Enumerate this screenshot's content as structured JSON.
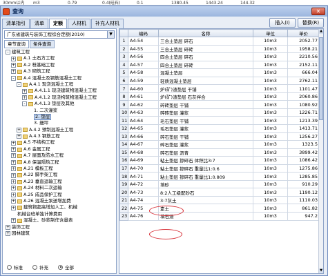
{
  "background_strip": [
    "30mm以内",
    "m3",
    "0.79",
    "0.4(硅石)",
    "0.1",
    "1380.45",
    "1443.24",
    "144.32"
  ],
  "window": {
    "title": "查询",
    "close_label": "✕"
  },
  "tabs": [
    "清单指引",
    "清单",
    "定额",
    "人材机",
    "补充人材机"
  ],
  "active_tab": 2,
  "buttons": {
    "insert": "插入(I)",
    "replace": "替换(R)"
  },
  "library": "广东省建筑与装饰工程综合定额(2010)",
  "subtabs": [
    "章节查询",
    "条件查询"
  ],
  "tree": [
    {
      "label": "建筑工程",
      "tog": "-",
      "depth": 0,
      "folder": false
    },
    {
      "label": "A.1 土石方工程",
      "tog": "+",
      "depth": 1,
      "folder": true
    },
    {
      "label": "A.2 桩基础工程",
      "tog": "+",
      "depth": 1,
      "folder": true
    },
    {
      "label": "A.3 砌筑工程",
      "tog": "+",
      "depth": 1,
      "folder": true
    },
    {
      "label": "A.4 混凝土及钢筋混凝土工程",
      "tog": "-",
      "depth": 1,
      "folder": true
    },
    {
      "label": "A.4.1 现浇混凝土工程",
      "tog": "-",
      "depth": 2,
      "folder": true
    },
    {
      "label": "A.4.1.1 现浇建筑物混凝土工程",
      "tog": "+",
      "depth": 3,
      "folder": true
    },
    {
      "label": "A.4.1.2 现浇构筑物混凝土工程",
      "tog": "+",
      "depth": 3,
      "folder": true
    },
    {
      "label": "A.4.1.3 垫层及其他",
      "tog": "-",
      "depth": 3,
      "folder": true
    },
    {
      "label": "1. 二次灌浆",
      "tog": "",
      "depth": 4,
      "folder": false
    },
    {
      "label": "2. 垫层",
      "tog": "",
      "depth": 4,
      "folder": false,
      "selected": true
    },
    {
      "label": "3. 细坪",
      "tog": "",
      "depth": 4,
      "folder": false
    },
    {
      "label": "A.4.2 预制混凝土工程",
      "tog": "+",
      "depth": 2,
      "folder": true
    },
    {
      "label": "A.4.3 钢筋工程",
      "tog": "+",
      "depth": 2,
      "folder": true
    },
    {
      "label": "A.5 不结构工程",
      "tog": "+",
      "depth": 1,
      "folder": true
    },
    {
      "label": "A.6 金属工程",
      "tog": "+",
      "depth": 1,
      "folder": true
    },
    {
      "label": "A.7 屋面及防水工程",
      "tog": "+",
      "depth": 1,
      "folder": true
    },
    {
      "label": "A.8 保温隔热工程",
      "tog": "+",
      "depth": 1,
      "folder": true
    },
    {
      "label": "A.21 模板工程",
      "tog": "+",
      "depth": 1,
      "folder": true
    },
    {
      "label": "A.22 脚手架工程",
      "tog": "+",
      "depth": 1,
      "folder": true
    },
    {
      "label": "A.23 垂直运输工程",
      "tog": "+",
      "depth": 1,
      "folder": true
    },
    {
      "label": "A.24 材料二次运输",
      "tog": "+",
      "depth": 1,
      "folder": true
    },
    {
      "label": "A.25 成品保护工程",
      "tog": "+",
      "depth": 1,
      "folder": true
    },
    {
      "label": "A.26 混凝土泵送增加费",
      "tog": "+",
      "depth": 1,
      "folder": true
    },
    {
      "label": "建筑物超高增加人工、机械",
      "tog": "+",
      "depth": 1,
      "folder": true
    },
    {
      "label": "机械台班单独计算费用",
      "tog": "",
      "depth": 1,
      "folder": false
    },
    {
      "label": "混凝土、砂浆制作含量表",
      "tog": "+",
      "depth": 1,
      "folder": true
    },
    {
      "label": "装饰工程",
      "tog": "+",
      "depth": 0,
      "folder": false
    },
    {
      "label": "园林建筑",
      "tog": "+",
      "depth": 0,
      "folder": false
    }
  ],
  "radios": [
    {
      "label": "标准",
      "checked": false
    },
    {
      "label": "补充",
      "checked": false
    },
    {
      "label": "全部",
      "checked": true
    }
  ],
  "table": {
    "headers": [
      "",
      "编码",
      "名称",
      "单位",
      "单价"
    ],
    "rows": [
      [
        "1",
        "A4-54",
        "三合土垫层 碎石",
        "10m3",
        "2052.77"
      ],
      [
        "2",
        "A4-55",
        "三合土垫层 碎砖",
        "10m3",
        "1958.21"
      ],
      [
        "3",
        "A4-56",
        "四合土垫层 碎石",
        "10m3",
        "2210.56"
      ],
      [
        "4",
        "A4-57",
        "四合土垫层 碎砖",
        "10m3",
        "2152.11"
      ],
      [
        "5",
        "A4-58",
        "混凝土垫层",
        "10m3",
        "666.04"
      ],
      [
        "6",
        "A4-59",
        "轻质混凝土垫层",
        "10m3",
        "2762.11"
      ],
      [
        "7",
        "A4-60",
        "炉(矿)渣垫层 干铺",
        "10m3",
        "1101.47"
      ],
      [
        "8",
        "A4-61",
        "炉(矿)渣垫层 石灰拌合",
        "10m3",
        "2060.86"
      ],
      [
        "9",
        "A4-62",
        "碎砖垫层 干铺",
        "10m3",
        "1080.92"
      ],
      [
        "10",
        "A4-63",
        "碎砖垫层 灌浆",
        "10m3",
        "1226.71"
      ],
      [
        "11",
        "A4-64",
        "毛石垫层 干铺",
        "10m3",
        "1213.39"
      ],
      [
        "12",
        "A4-65",
        "毛石垫层 灌浆",
        "10m3",
        "1413.71"
      ],
      [
        "13",
        "A4-66",
        "碎石垫层 干铺",
        "10m3",
        "1256.27"
      ],
      [
        "14",
        "A4-67",
        "碎石垫层 灌浆",
        "10m3",
        "1323.5"
      ],
      [
        "15",
        "A4-68",
        "碎石垫层 沥青",
        "10m3",
        "3899.42"
      ],
      [
        "16",
        "A4-69",
        "粘土垫层 掺碎石 体积比3:7",
        "10m3",
        "1086.42"
      ],
      [
        "17",
        "A4-70",
        "粘土垫层 掺碎石 重量比1:0.6",
        "10m3",
        "1275.86"
      ],
      [
        "18",
        "A4-71",
        "粘土垫层 掺碎石 重量比1:0.809",
        "10m3",
        "1285.85"
      ],
      [
        "19",
        "A4-72",
        "填砂",
        "10m3",
        "910.29"
      ],
      [
        "20",
        "A4-73",
        "8:2人工级配砂石",
        "10m3",
        "1190.12"
      ],
      [
        "21",
        "A4-74",
        "3:7灰土",
        "10m3",
        "1110.03"
      ],
      [
        "22",
        "A4-75",
        "素土",
        "10m3",
        "861.82"
      ],
      [
        "23",
        "A4-76",
        "填石渣",
        "10m3",
        "947.2"
      ]
    ]
  }
}
